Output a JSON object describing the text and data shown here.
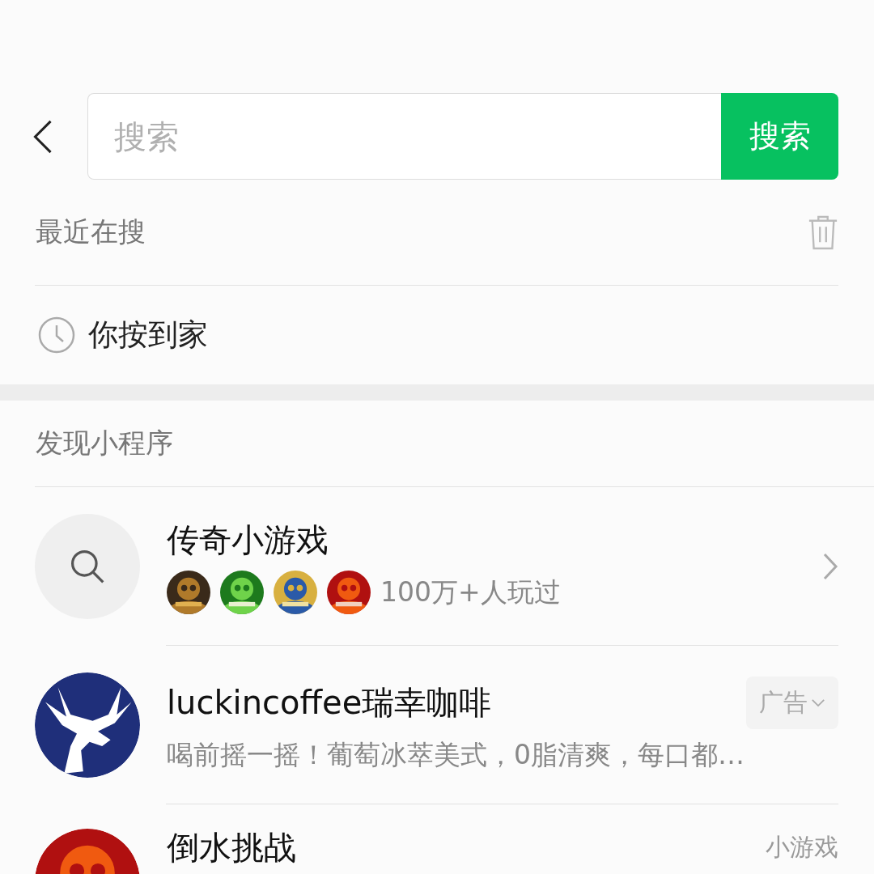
{
  "search": {
    "placeholder": "搜索",
    "button": "搜索"
  },
  "recent": {
    "title": "最近在搜",
    "items": [
      {
        "text": "你按到家"
      }
    ]
  },
  "discover": {
    "title": "发现小程序",
    "items": [
      {
        "kind": "search",
        "title": "传奇小游戏",
        "subtitle": "100万+人玩过"
      },
      {
        "kind": "ad",
        "title": "luckincoffee瑞幸咖啡",
        "tag": "广告",
        "subtitle": "喝前摇一摇！葡萄冰萃美式，0脂清爽，每口都…"
      },
      {
        "kind": "game",
        "title": "倒水挑战",
        "tag": "小游戏"
      }
    ]
  }
}
